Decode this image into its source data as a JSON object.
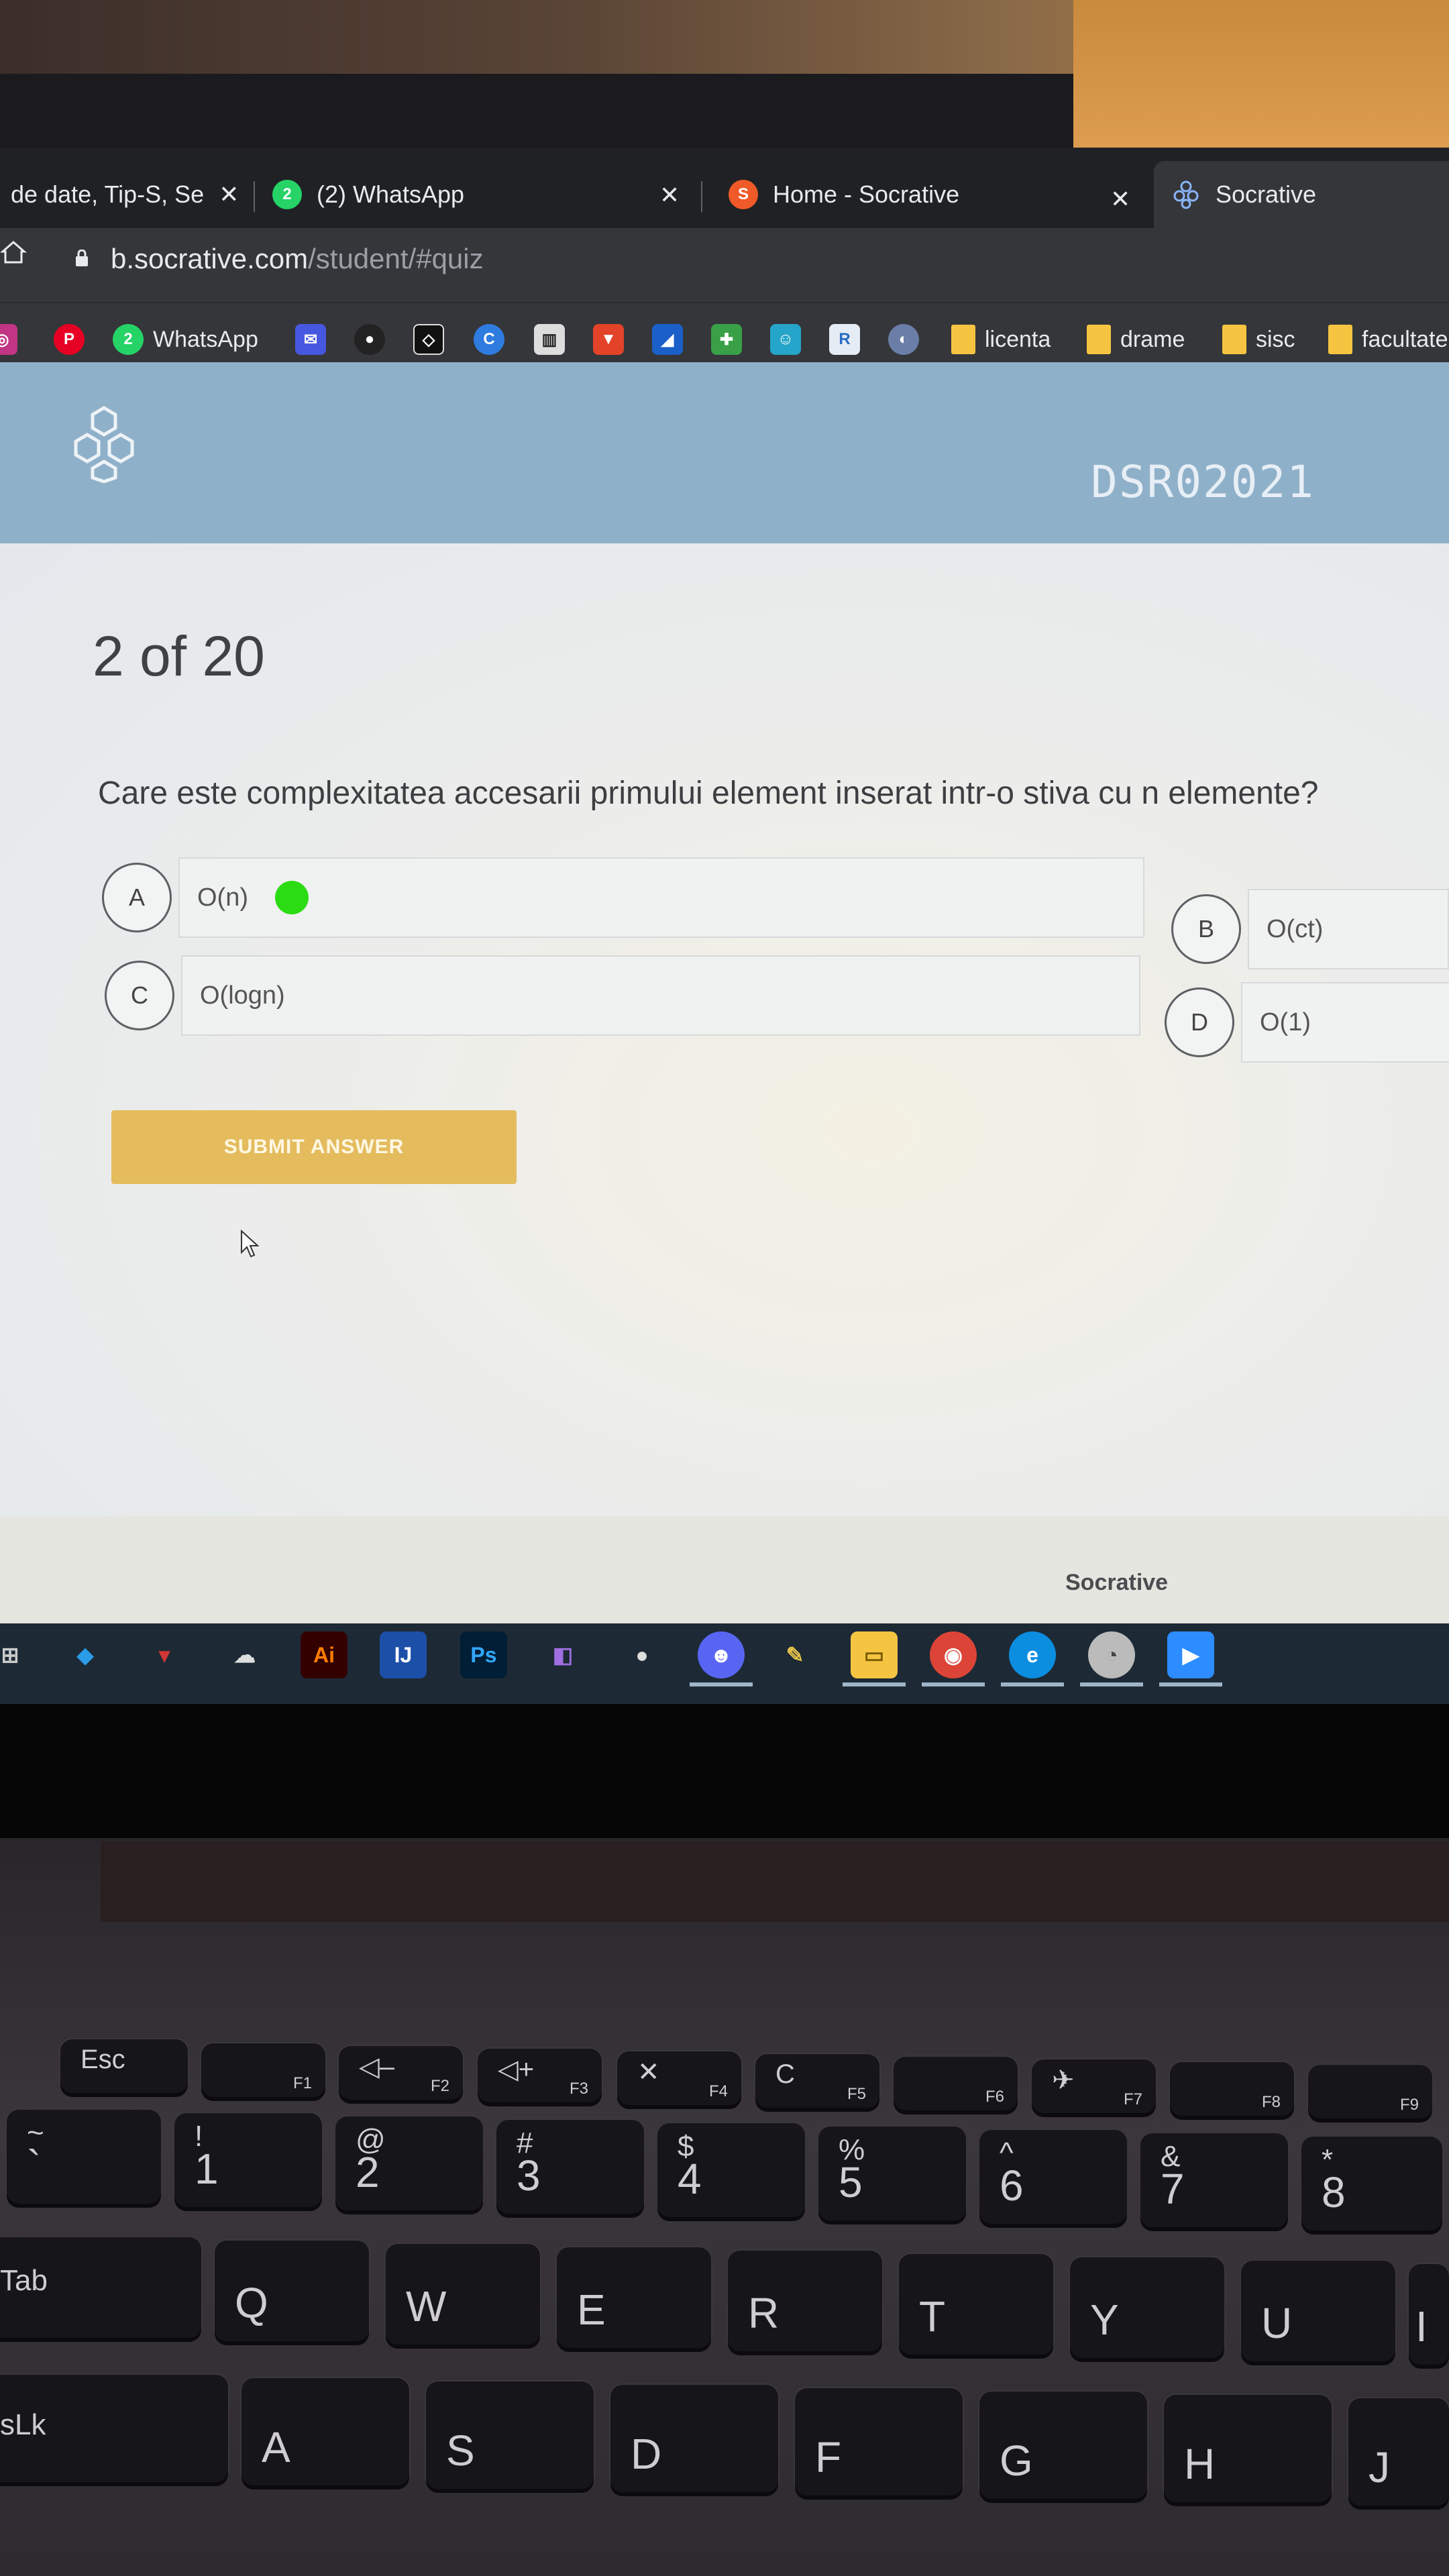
{
  "browser": {
    "tabs": [
      {
        "title": "de date, Tip-S, Se",
        "close": "✕"
      },
      {
        "title": "(2) WhatsApp",
        "badge": "2",
        "close": "✕"
      },
      {
        "title": "Home - Socrative",
        "close": "✕"
      },
      {
        "title": "Socrative"
      }
    ],
    "url_host": "b.socrative.com",
    "url_path": "/student/#quiz",
    "bookmarks": {
      "whatsapp": "WhatsApp",
      "folders": [
        "licenta",
        "drame",
        "sisc",
        "facultate"
      ]
    }
  },
  "socrative": {
    "room_name": "DSR02021",
    "counter": "2 of 20",
    "question": "Care este complexitatea accesarii primului element inserat intr-o stiva cu n elemente?",
    "answers": [
      {
        "letter": "A",
        "text": "O(n)",
        "selected": true
      },
      {
        "letter": "B",
        "text": "O(ct)"
      },
      {
        "letter": "C",
        "text": "O(logn)"
      },
      {
        "letter": "D",
        "text": "O(1)"
      }
    ],
    "submit_label": "SUBMIT ANSWER",
    "footer_brand": "Socrative",
    "selected_color": "#2bdc12",
    "submit_color": "#e4bc5e"
  },
  "taskbar": {
    "apps": [
      "vscode-icon",
      "app-icon",
      "app-icon",
      "illustrator-icon",
      "intellij-icon",
      "photoshop-icon",
      "visual-studio-icon",
      "github-icon",
      "discord-icon",
      "app-icon",
      "file-explorer-icon",
      "chrome-icon",
      "edge-icon",
      "app-icon",
      "zoom-icon"
    ],
    "labels": {
      "illustrator": "Ai",
      "photoshop": "Ps"
    }
  },
  "keyboard": {
    "fn_row": [
      {
        "name": "Esc",
        "sub": ""
      },
      {
        "name": "",
        "sub": "F1"
      },
      {
        "name": "◁–",
        "sub": "F2"
      },
      {
        "name": "◁+",
        "sub": "F3"
      },
      {
        "name": "✕",
        "sub": "F4"
      },
      {
        "name": "C",
        "sub": "F5"
      },
      {
        "name": "",
        "sub": "F6"
      },
      {
        "name": "✈",
        "sub": "F7"
      },
      {
        "name": "",
        "sub": "F8"
      },
      {
        "name": "",
        "sub": "F9"
      }
    ],
    "number_row": [
      {
        "top": "~",
        "main": "`"
      },
      {
        "top": "!",
        "main": "1"
      },
      {
        "top": "@",
        "main": "2"
      },
      {
        "top": "#",
        "main": "3"
      },
      {
        "top": "$",
        "main": "4"
      },
      {
        "top": "%",
        "main": "5"
      },
      {
        "top": "^",
        "main": "6"
      },
      {
        "top": "&",
        "main": "7"
      },
      {
        "top": "*",
        "main": "8"
      }
    ],
    "tab": "Tab",
    "q_row": [
      "Q",
      "W",
      "E",
      "R",
      "T",
      "Y",
      "U",
      "I"
    ],
    "capslock": "sLk",
    "a_row": [
      "A",
      "S",
      "D",
      "F",
      "G",
      "H",
      "J"
    ]
  }
}
